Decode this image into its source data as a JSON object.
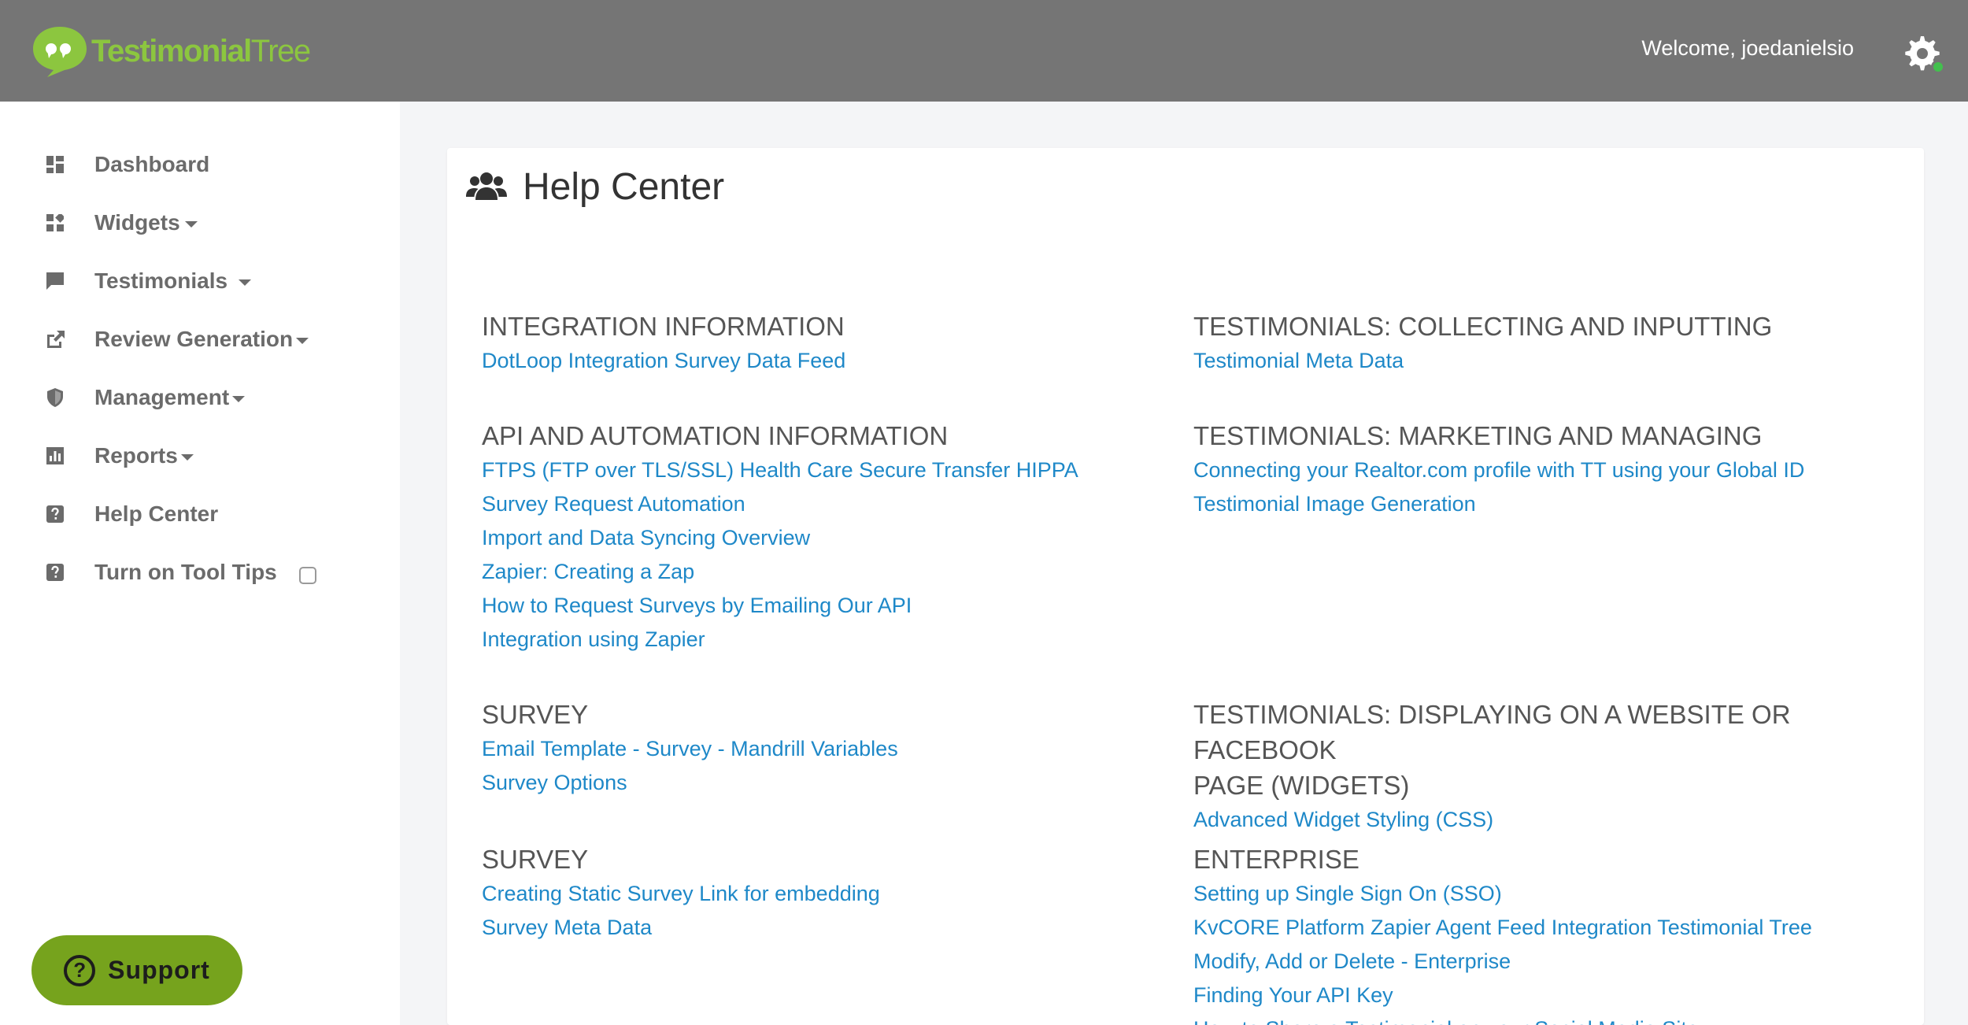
{
  "brand": {
    "logo_word_1": "Testimonial",
    "logo_word_2": "Tree",
    "accent": "#8cc63f"
  },
  "header": {
    "welcome": "Welcome, joedanielsio",
    "settings_icon": "gear-icon",
    "status_color": "#43c04e"
  },
  "sidebar": {
    "items": [
      {
        "label": "Dashboard",
        "icon": "dashboard-icon"
      },
      {
        "label": "Widgets",
        "icon": "widgets-icon"
      },
      {
        "label": "Testimonials",
        "icon": "comment-icon"
      },
      {
        "label": "Review Generation",
        "icon": "share-icon"
      },
      {
        "label": "Management",
        "icon": "shield-icon"
      },
      {
        "label": "Reports",
        "icon": "bar-chart-icon"
      },
      {
        "label": "Help Center",
        "icon": "question-icon"
      },
      {
        "label": "Turn on Tool Tips",
        "icon": "question-icon"
      }
    ],
    "support_label": "Support"
  },
  "main": {
    "title": "Help Center",
    "sections": {
      "integration": {
        "title": "INTEGRATION INFORMATION",
        "links": [
          "DotLoop Integration Survey Data Feed"
        ]
      },
      "api": {
        "title": "API AND AUTOMATION INFORMATION",
        "links": [
          "FTPS (FTP over TLS/SSL) Health Care Secure Transfer HIPPA",
          "Survey Request Automation",
          "Import and Data Syncing Overview",
          "Zapier: Creating a Zap",
          "How to Request Surveys by Emailing Our API",
          "Integration using Zapier"
        ]
      },
      "survey1": {
        "title": "SURVEY",
        "links": [
          "Email Template - Survey - Mandrill Variables",
          "Survey Options"
        ]
      },
      "survey2": {
        "title": "SURVEY",
        "links": [
          "Creating Static Survey Link for embedding",
          "Survey Meta Data"
        ]
      },
      "collecting": {
        "title": "TESTIMONIALS: COLLECTING AND INPUTTING",
        "links": [
          "Testimonial Meta Data"
        ]
      },
      "marketing": {
        "title": "TESTIMONIALS: MARKETING AND MANAGING",
        "links": [
          "Connecting your Realtor.com profile with TT using your Global ID",
          "Testimonial Image Generation"
        ]
      },
      "displaying": {
        "title_line1": "TESTIMONIALS: DISPLAYING ON A WEBSITE OR FACEBOOK",
        "title_line2": "PAGE (WIDGETS)",
        "links": [
          "Advanced Widget Styling (CSS)"
        ]
      },
      "enterprise": {
        "title": "ENTERPRISE",
        "links": [
          "Setting up Single Sign On (SSO)",
          "KvCORE Platform Zapier Agent Feed Integration Testimonial Tree",
          "Modify, Add or Delete - Enterprise",
          "Finding Your API Key",
          "How to Share a Testimonial on your Social Media Site"
        ]
      }
    }
  }
}
